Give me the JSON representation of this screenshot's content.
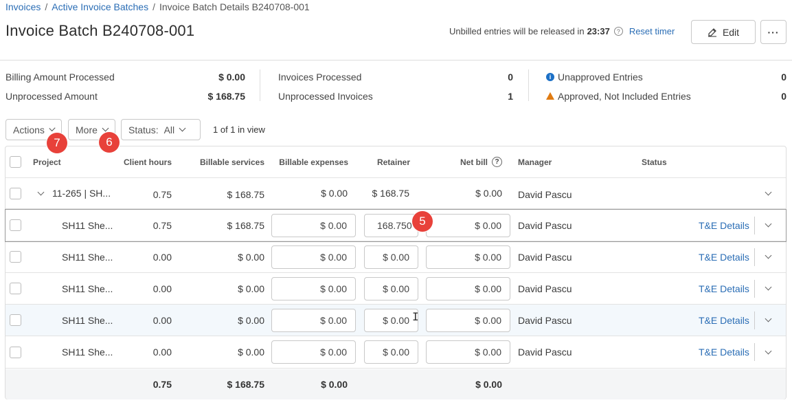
{
  "breadcrumb": {
    "items": [
      "Invoices",
      "Active Invoice Batches",
      "Invoice Batch Details B240708-001"
    ],
    "sep": "/"
  },
  "page_title": "Invoice Batch B240708-001",
  "timer": {
    "text": "Unbilled entries will be released in",
    "time": "23:37",
    "reset": "Reset timer"
  },
  "buttons": {
    "edit": "Edit",
    "more": "···"
  },
  "summary": {
    "col1": [
      {
        "label": "Billing Amount Processed",
        "value": "$ 0.00"
      },
      {
        "label": "Unprocessed Amount",
        "value": "$ 168.75"
      }
    ],
    "col2": [
      {
        "label": "Invoices Processed",
        "value": "0"
      },
      {
        "label": "Unprocessed Invoices",
        "value": "1"
      }
    ],
    "col3": [
      {
        "label": "Unapproved Entries",
        "value": "0",
        "icon": "info-icon"
      },
      {
        "label": "Approved, Not Included Entries",
        "value": "0",
        "icon": "warning-icon"
      }
    ]
  },
  "toolbar": {
    "actions": "Actions",
    "more": "More",
    "status_label": "Status:",
    "status_value": "All",
    "count": "1 of 1 in view"
  },
  "badges": {
    "actions": "7",
    "more": "6",
    "retainer": "5"
  },
  "table": {
    "headers": {
      "project": "Project",
      "client_hours": "Client hours",
      "billable_services": "Billable services",
      "billable_expenses": "Billable expenses",
      "retainer": "Retainer",
      "net_bill": "Net bill",
      "net_help": "?",
      "manager": "Manager",
      "status": "Status"
    },
    "group": {
      "project": "11-265 | SH...",
      "client_hours": "0.75",
      "billable_services": "$ 168.75",
      "billable_expenses": "$ 0.00",
      "retainer": "$ 168.75",
      "net_bill": "$ 0.00",
      "manager": "David Pascu"
    },
    "rows": [
      {
        "project": "SH11 She...",
        "client_hours": "0.75",
        "billable_services": "$ 168.75",
        "billable_expenses": "$ 0.00",
        "retainer": "168.750",
        "net_bill": "$ 0.00",
        "manager": "David Pascu",
        "link": "T&E Details"
      },
      {
        "project": "SH11 She...",
        "client_hours": "0.00",
        "billable_services": "$ 0.00",
        "billable_expenses": "$ 0.00",
        "retainer": "$ 0.00",
        "net_bill": "$ 0.00",
        "manager": "David Pascu",
        "link": "T&E Details"
      },
      {
        "project": "SH11 She...",
        "client_hours": "0.00",
        "billable_services": "$ 0.00",
        "billable_expenses": "$ 0.00",
        "retainer": "$ 0.00",
        "net_bill": "$ 0.00",
        "manager": "David Pascu",
        "link": "T&E Details"
      },
      {
        "project": "SH11 She...",
        "client_hours": "0.00",
        "billable_services": "$ 0.00",
        "billable_expenses": "$ 0.00",
        "retainer": "$ 0.00",
        "net_bill": "$ 0.00",
        "manager": "David Pascu",
        "link": "T&E Details"
      },
      {
        "project": "SH11 She...",
        "client_hours": "0.00",
        "billable_services": "$ 0.00",
        "billable_expenses": "$ 0.00",
        "retainer": "$ 0.00",
        "net_bill": "$ 0.00",
        "manager": "David Pascu",
        "link": "T&E Details"
      }
    ],
    "totals": {
      "client_hours": "0.75",
      "billable_services": "$ 168.75",
      "billable_expenses": "$ 0.00",
      "net_bill": "$ 0.00"
    }
  }
}
